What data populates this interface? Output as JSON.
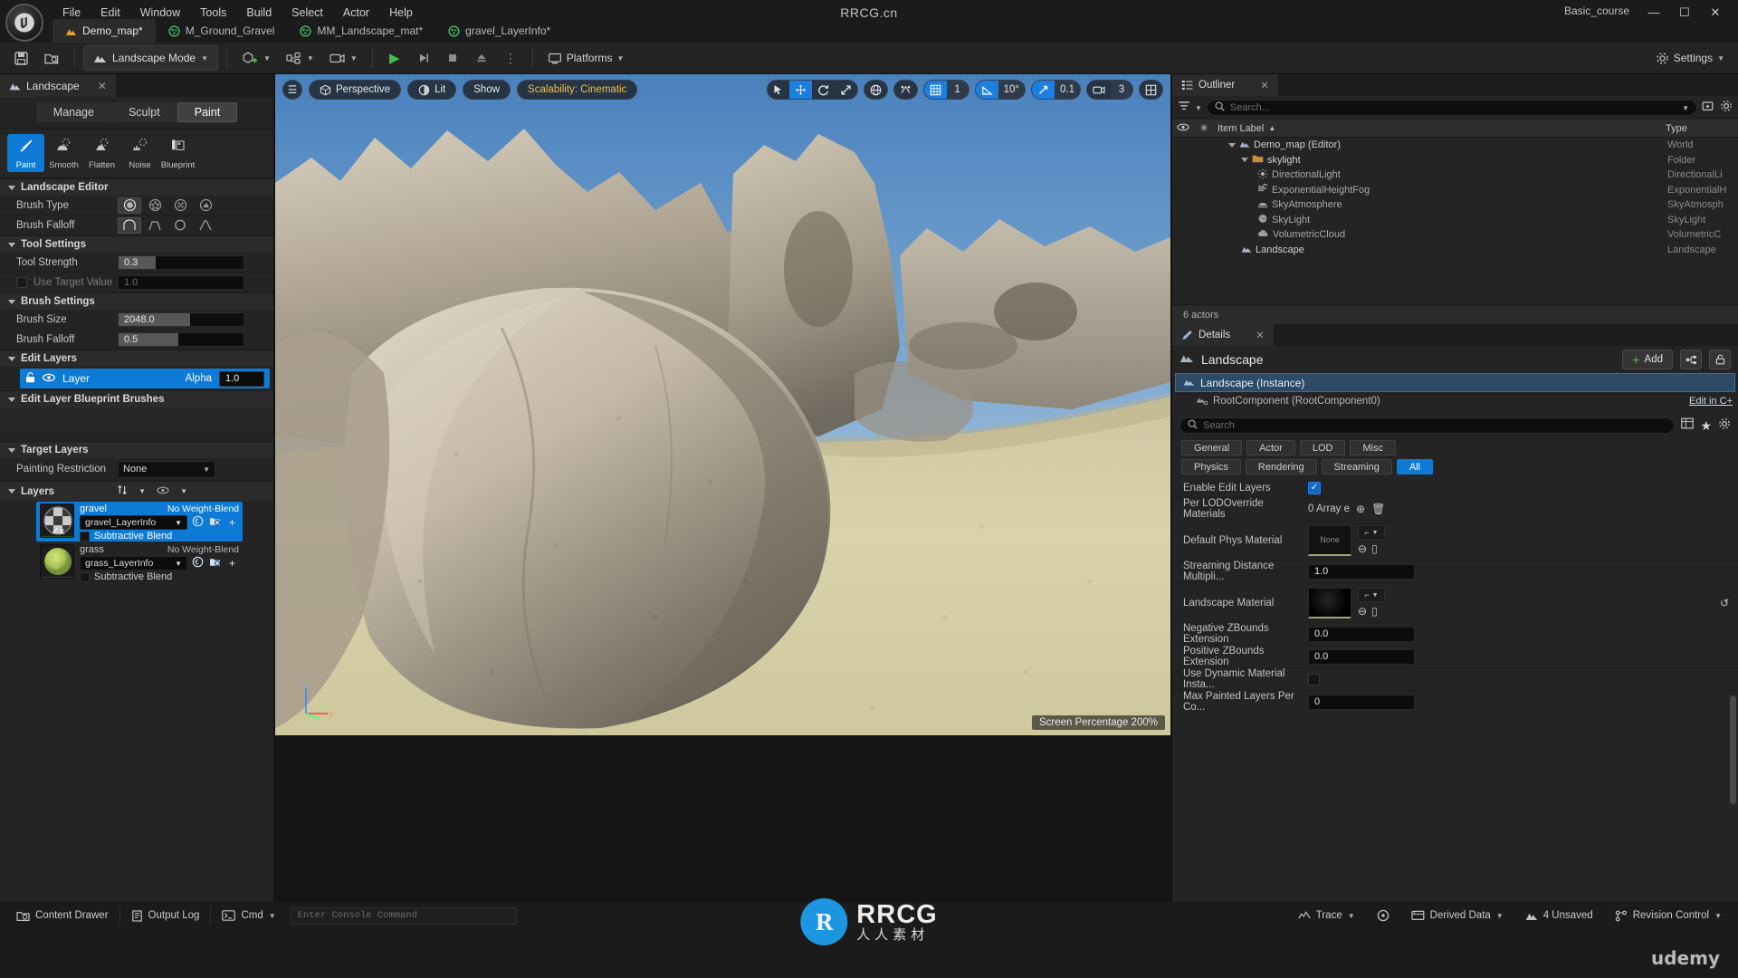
{
  "app": {
    "title_center": "RRCG.cn",
    "title_right": "Basic_course",
    "logo_glyph": "Ʊ"
  },
  "menubar": [
    "File",
    "Edit",
    "Window",
    "Tools",
    "Build",
    "Select",
    "Actor",
    "Help"
  ],
  "tabs": [
    {
      "label": "Demo_map*",
      "icon": "landscape-icon",
      "active": true
    },
    {
      "label": "M_Ground_Gravel",
      "icon": "material-icon",
      "active": false
    },
    {
      "label": "MM_Landscape_mat*",
      "icon": "material-icon",
      "active": false
    },
    {
      "label": "gravel_LayerInfo*",
      "icon": "material-icon",
      "active": false
    }
  ],
  "window_controls": {
    "minimize": "—",
    "maximize": "☐",
    "close": "✕"
  },
  "toolbar": {
    "save_label": "",
    "mode_label": "Landscape Mode",
    "platforms_label": "Platforms",
    "settings_label": "Settings",
    "play_glyph": "▶",
    "step_glyph": "▷|",
    "stop_glyph": "■",
    "eject_glyph": "⏏"
  },
  "left_panel": {
    "tab_label": "Landscape",
    "close_glyph": "✕",
    "mode_tabs": [
      {
        "label": "Manage",
        "selected": false
      },
      {
        "label": "Sculpt",
        "selected": false
      },
      {
        "label": "Paint",
        "selected": true
      }
    ],
    "tools": [
      {
        "label": "Paint",
        "selected": true,
        "glyph": "✎"
      },
      {
        "label": "Smooth",
        "selected": false,
        "glyph": "◠"
      },
      {
        "label": "Flatten",
        "selected": false,
        "glyph": "△"
      },
      {
        "label": "Noise",
        "selected": false,
        "glyph": "░"
      },
      {
        "label": "Blueprint",
        "selected": false,
        "glyph": "▥"
      }
    ],
    "sections": {
      "landscape_editor": "Landscape Editor",
      "tool_settings": "Tool Settings",
      "brush_settings": "Brush Settings",
      "edit_layers": "Edit Layers",
      "edit_layer_bp_brushes": "Edit Layer Blueprint Brushes",
      "target_layers": "Target Layers",
      "layers": "Layers"
    },
    "brush_type": {
      "label": "Brush Type",
      "options": [
        "circle",
        "star",
        "pattern",
        "component"
      ],
      "selected_index": 0
    },
    "brush_falloff_shape": {
      "label": "Brush Falloff",
      "options": [
        "smooth",
        "linear",
        "spherical",
        "tip"
      ],
      "selected_index": 0
    },
    "tool_strength": {
      "label": "Tool Strength",
      "value": "0.3",
      "fill_pct": 30
    },
    "use_target_value": {
      "label": "Use Target Value",
      "value": "1.0",
      "checked": false
    },
    "brush_size": {
      "label": "Brush Size",
      "value": "2048.0",
      "fill_pct": 57
    },
    "brush_falloff": {
      "label": "Brush Falloff",
      "value": "0.5",
      "fill_pct": 48
    },
    "edit_layer": {
      "name": "Layer",
      "alpha_label": "Alpha",
      "alpha_value": "1.0",
      "lock_glyph": "🔓",
      "eye_glyph": "◉"
    },
    "painting_restriction": {
      "label": "Painting Restriction",
      "value": "None"
    },
    "layer_list": [
      {
        "name": "gravel",
        "layerinfo": "gravel_LayerInfo",
        "weight_label": "No Weight-Blend",
        "blend_label": "Subtractive Blend",
        "blend_checked": false,
        "selected": true,
        "thumb": "checker"
      },
      {
        "name": "grass",
        "layerinfo": "grass_LayerInfo",
        "weight_label": "No Weight-Blend",
        "blend_label": "Subtractive Blend",
        "blend_checked": false,
        "selected": false,
        "thumb": "grass"
      }
    ]
  },
  "viewport": {
    "menu_glyph": "☰",
    "perspective": "Perspective",
    "lit": "Lit",
    "show": "Show",
    "scalability": "Scalability: Cinematic",
    "transform_tools": [
      {
        "name": "select-tool",
        "glyph": "➤",
        "active": false
      },
      {
        "name": "move-tool",
        "glyph": "✥",
        "active": true
      },
      {
        "name": "rotate-tool",
        "glyph": "↻",
        "active": false
      },
      {
        "name": "scale-tool",
        "glyph": "⤡",
        "active": false
      }
    ],
    "world_glyph": "⊕",
    "surface_snap_glyph": "⁂",
    "grid_snap": {
      "icon": "grid-icon",
      "value": "1",
      "on": true
    },
    "angle_snap": {
      "icon": "angle-icon",
      "value": "10°",
      "on": true
    },
    "scale_snap": {
      "icon": "scale-icon",
      "value": "0.1",
      "on": true
    },
    "camera_speed": {
      "icon": "camera-icon",
      "value": "3",
      "on": false
    },
    "layout_glyph": "⊞",
    "screen_percentage": "Screen Percentage  200%",
    "axis_x": "x",
    "axis_y": "y",
    "axis_z": "z"
  },
  "outliner": {
    "tab_label": "Outliner",
    "close_glyph": "✕",
    "search_placeholder": "Search...",
    "columns": {
      "item_label": "Item Label",
      "type": "Type",
      "sort_glyph": "▲"
    },
    "rows": [
      {
        "label": "Demo_map (Editor)",
        "type": "World",
        "indent": 1,
        "icon": "landscape-icon",
        "expander": true
      },
      {
        "label": "skylight",
        "type": "Folder",
        "indent": 2,
        "icon": "folder-icon",
        "expander": true
      },
      {
        "label": "DirectionalLight",
        "type": "DirectionalLi",
        "indent": 3,
        "icon": "light-icon",
        "expander": false
      },
      {
        "label": "ExponentialHeightFog",
        "type": "ExponentialH",
        "indent": 3,
        "icon": "fog-icon",
        "expander": false
      },
      {
        "label": "SkyAtmosphere",
        "type": "SkyAtmosph",
        "indent": 3,
        "icon": "atmosphere-icon",
        "expander": false
      },
      {
        "label": "SkyLight",
        "type": "SkyLight",
        "indent": 3,
        "icon": "skylight-icon",
        "expander": false
      },
      {
        "label": "VolumetricCloud",
        "type": "VolumetricC",
        "indent": 3,
        "icon": "cloud-icon",
        "expander": false
      },
      {
        "label": "Landscape",
        "type": "Landscape",
        "indent": 2,
        "icon": "landscape-icon",
        "expander": false
      }
    ],
    "footer": "6 actors"
  },
  "details": {
    "tab_label": "Details",
    "close_glyph": "✕",
    "object_title": "Landscape",
    "add_label": "Add",
    "instance_row": "Landscape (Instance)",
    "root_row": "RootComponent (RootComponent0)",
    "edit_in_cpp": "Edit in C+",
    "search_placeholder": "Search",
    "filter_tabs_row1": [
      {
        "label": "General",
        "selected": false
      },
      {
        "label": "Actor",
        "selected": false
      },
      {
        "label": "LOD",
        "selected": false
      },
      {
        "label": "Misc",
        "selected": false
      }
    ],
    "filter_tabs_row2": [
      {
        "label": "Physics",
        "selected": false
      },
      {
        "label": "Rendering",
        "selected": false
      },
      {
        "label": "Streaming",
        "selected": false
      },
      {
        "label": "All",
        "selected": true
      }
    ],
    "properties": [
      {
        "label": "Enable Edit Layers",
        "kind": "checkbox",
        "value": "true"
      },
      {
        "label": "Per LODOverride Materials",
        "kind": "array",
        "value": "0 Array e"
      },
      {
        "label": "Default Phys Material",
        "kind": "asset",
        "value": "None"
      },
      {
        "label": "Streaming Distance Multipli...",
        "kind": "text",
        "value": "1.0"
      },
      {
        "label": "Landscape Material",
        "kind": "asset-black",
        "value": ""
      },
      {
        "label": "Negative ZBounds Extension",
        "kind": "text",
        "value": "0.0"
      },
      {
        "label": "Positive ZBounds Extension",
        "kind": "text",
        "value": "0.0"
      },
      {
        "label": "Use Dynamic Material Insta...",
        "kind": "checkbox-off",
        "value": "false"
      },
      {
        "label": "Max Painted Layers Per Co...",
        "kind": "text",
        "value": "0"
      }
    ]
  },
  "statusbar": {
    "content_drawer": "Content Drawer",
    "output_log": "Output Log",
    "cmd": "Cmd",
    "console_placeholder": "Enter Console Command",
    "trace": "Trace",
    "derived_data": "Derived Data",
    "unsaved": "4 Unsaved",
    "revision_control": "Revision Control",
    "udemy": "udemy"
  },
  "watermark": {
    "brand_main": "RRCG",
    "brand_sub": "人人素材",
    "brand_letter": "R"
  },
  "colors": {
    "accent_blue": "#0d7ad6",
    "panel_bg": "#242424",
    "dark_bg": "#1b1b1b",
    "scalability_yellow": "#f0c040",
    "play_green": "#3fbf4a"
  }
}
